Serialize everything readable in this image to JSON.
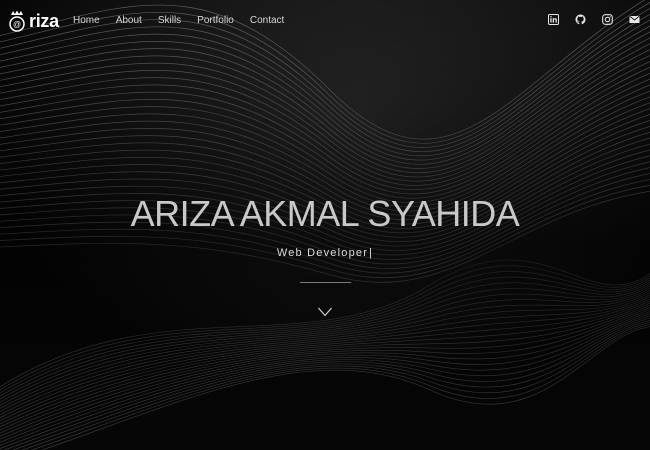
{
  "brand": {
    "logo_text": "riza"
  },
  "nav": {
    "items": [
      {
        "label": "Home"
      },
      {
        "label": "About"
      },
      {
        "label": "Skills"
      },
      {
        "label": "Portfolio"
      },
      {
        "label": "Contact"
      }
    ]
  },
  "socials": [
    {
      "icon": "linkedin-icon"
    },
    {
      "icon": "github-icon"
    },
    {
      "icon": "instagram-icon"
    },
    {
      "icon": "email-icon"
    }
  ],
  "hero": {
    "name": "ARIZA AKMAL SYAHIDA",
    "role": "Web Developer",
    "cursor": "|"
  },
  "scroll": {
    "icon": "chevron-down-icon"
  },
  "colors": {
    "background": "#060606",
    "wave_lines": "#8a8a8a",
    "name_text": "#c9c9c9",
    "nav_text": "#d6d6d6"
  }
}
